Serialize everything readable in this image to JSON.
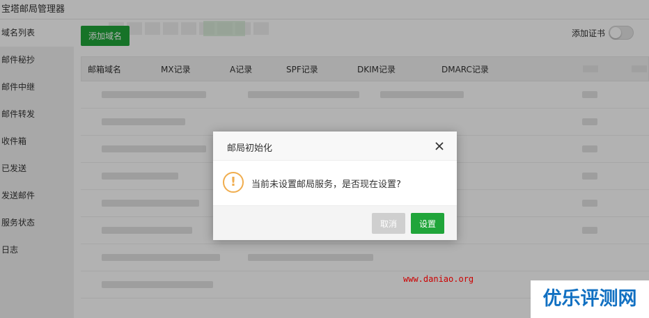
{
  "app": {
    "title": "宝塔邮局管理器"
  },
  "sidebar": {
    "items": [
      {
        "label": "域名列表",
        "active": true
      },
      {
        "label": "邮件秘抄"
      },
      {
        "label": "邮件中继"
      },
      {
        "label": "邮件转发"
      },
      {
        "label": "收件箱"
      },
      {
        "label": "已发送"
      },
      {
        "label": "发送邮件"
      },
      {
        "label": "服务状态"
      },
      {
        "label": "日志"
      }
    ]
  },
  "toolbar": {
    "add_domain_label": "添加域名",
    "add_cert_label": "添加证书",
    "add_cert_enabled": false
  },
  "table": {
    "columns": [
      "邮箱域名",
      "MX记录",
      "A记录",
      "SPF记录",
      "DKIM记录",
      "DMARC记录"
    ]
  },
  "dialog": {
    "title": "邮局初始化",
    "icon": "!",
    "message": "当前未设置邮局服务，是否现在设置?",
    "cancel_label": "取消",
    "confirm_label": "设置"
  },
  "watermark": {
    "url": "www.daniao.org",
    "brand": "优乐评测网"
  },
  "colors": {
    "primary_green": "#20a53a",
    "warning_orange": "#f0ad4e",
    "watermark_red": "#cc0000",
    "watermark_blue": "#1170c2"
  }
}
